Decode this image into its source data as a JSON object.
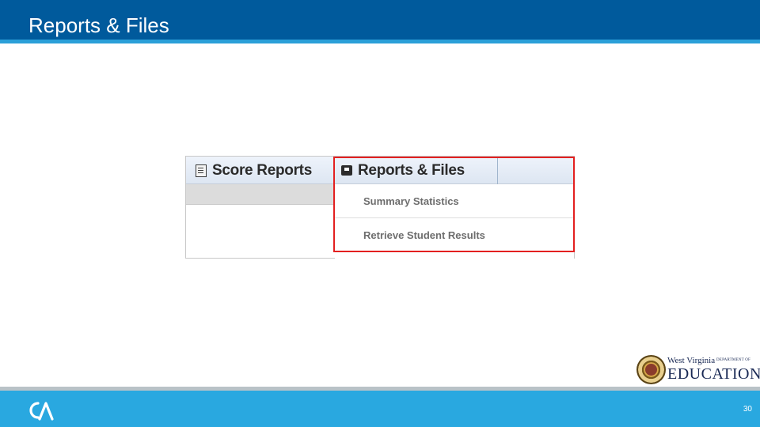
{
  "slide": {
    "title": "Reports & Files",
    "page_number": "30"
  },
  "mock_ui": {
    "tabs": [
      {
        "label": "Score Reports",
        "icon": "document-icon"
      },
      {
        "label": "Reports & Files",
        "icon": "folder-box-icon"
      }
    ],
    "menu_items": [
      {
        "label": "Summary Statistics"
      },
      {
        "label": "Retrieve Student Results"
      }
    ],
    "highlight_color": "#e32020"
  },
  "logo": {
    "line1": "West Virginia",
    "line2": "DEPARTMENT OF",
    "line3": "EDUCATION"
  },
  "colors": {
    "header": "#005a9c",
    "header_accent": "#2a9fd8",
    "footer": "#29a8e0"
  }
}
